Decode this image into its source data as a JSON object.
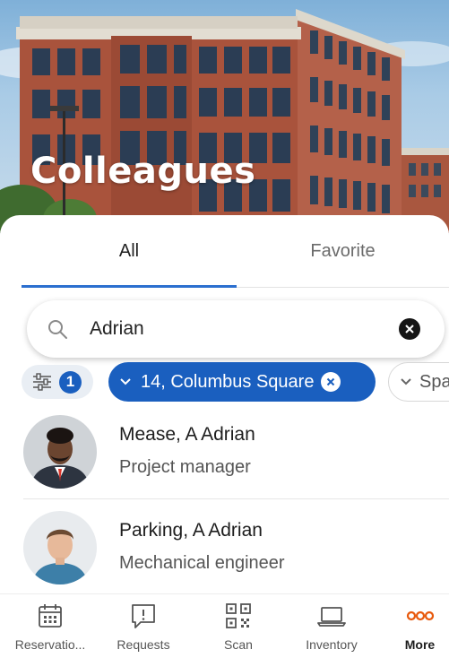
{
  "header": {
    "title": "Colleagues"
  },
  "tabs": [
    {
      "label": "All",
      "active": true
    },
    {
      "label": "Favorite",
      "active": false
    }
  ],
  "search": {
    "value": "Adrian",
    "placeholder": ""
  },
  "filters": {
    "active_count": "1",
    "location": "14, Columbus Square",
    "space": "Spa"
  },
  "colleagues": [
    {
      "name": "Mease, A Adrian",
      "role": "Project manager"
    },
    {
      "name": "Parking, A Adrian",
      "role": "Mechanical engineer"
    }
  ],
  "nav": [
    {
      "label": "Reservatio...",
      "icon": "calendar-icon"
    },
    {
      "label": "Requests",
      "icon": "request-bubble-icon"
    },
    {
      "label": "Scan",
      "icon": "qr-code-icon"
    },
    {
      "label": "Inventory",
      "icon": "laptop-icon"
    },
    {
      "label": "More",
      "icon": "more-dots-icon",
      "active": true
    }
  ],
  "colors": {
    "accent": "#1a5fbf",
    "tab_underline": "#2b6fcf",
    "more_icon": "#e8590c"
  }
}
